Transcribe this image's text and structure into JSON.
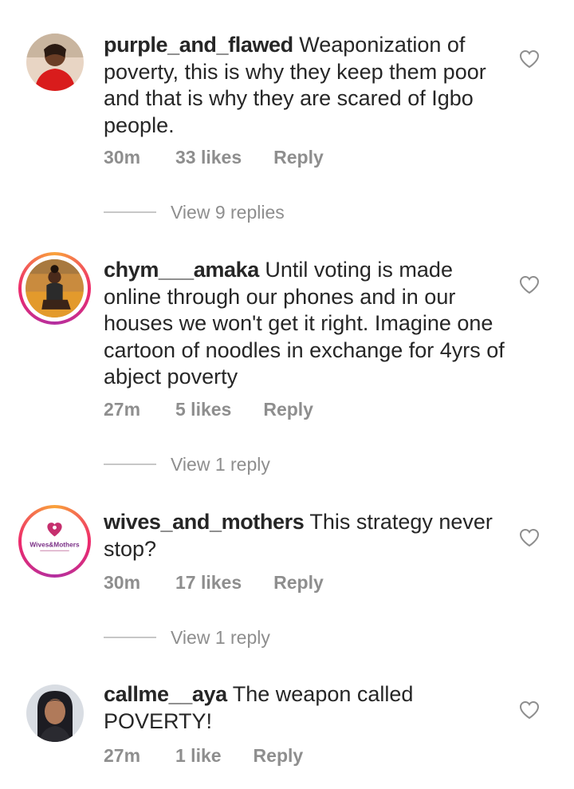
{
  "comments": [
    {
      "username": "purple_and_flawed",
      "text": " Weaponization of poverty, this is why they keep them poor and that is why they are scared of Igbo people.",
      "time": "30m",
      "likes": "33 likes",
      "reply_label": "Reply",
      "view_replies": "View 9 replies"
    },
    {
      "username": "chym___amaka",
      "text": " Until voting is made online through our phones and in our houses  we won't get it right. Imagine one cartoon of noodles in exchange for 4yrs of abject poverty",
      "time": "27m",
      "likes": "5 likes",
      "reply_label": "Reply",
      "view_replies": "View 1 reply"
    },
    {
      "username": "wives_and_mothers",
      "text": " This strategy never stop?",
      "time": "30m",
      "likes": "17 likes",
      "reply_label": "Reply",
      "view_replies": "View 1 reply",
      "avatar_logo_text": "Wives&Mothers"
    },
    {
      "username": "callme__aya",
      "text": " The weapon called POVERTY!",
      "time": "27m",
      "likes": "1 like",
      "reply_label": "Reply"
    }
  ],
  "colors": {
    "text": "#262626",
    "muted": "#8e8e8e",
    "story_ring_start": "#f9a33a",
    "story_ring_end": "#b32fa0"
  },
  "icons": {
    "like": "heart-outline-icon"
  }
}
